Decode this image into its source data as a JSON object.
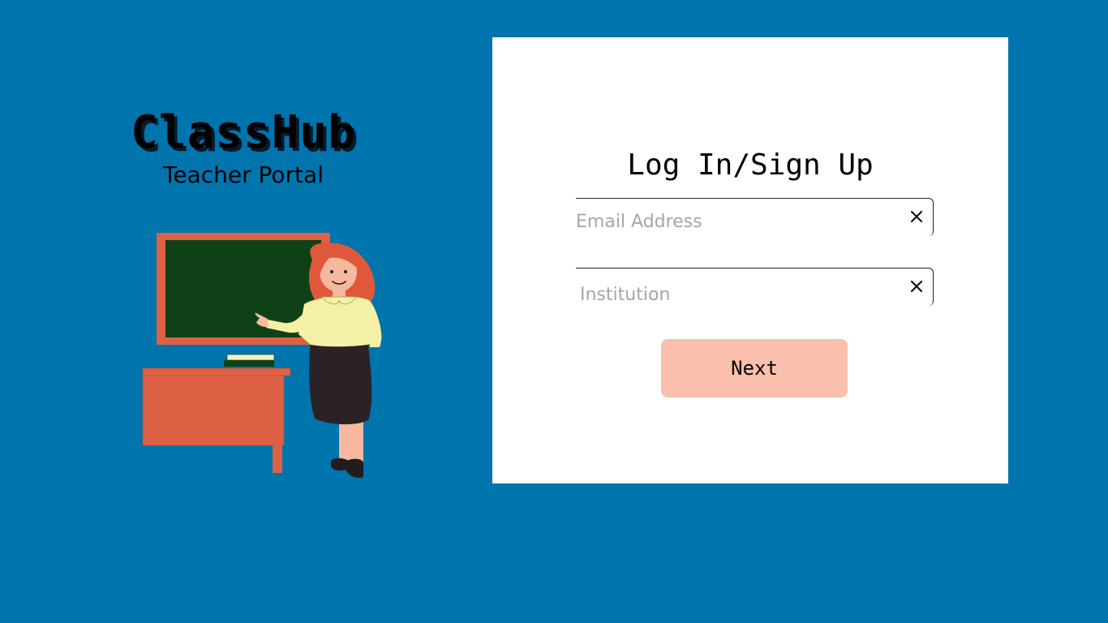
{
  "brand": {
    "title": "ClassHub",
    "subtitle": "Teacher Portal"
  },
  "illustration": {
    "icon": "teacher-at-chalkboard-illustration"
  },
  "login": {
    "title": "Log In/Sign Up",
    "email_placeholder": "Email Address",
    "email_value": "",
    "institution_placeholder": "Institution",
    "institution_value": "",
    "clear_icon": "close-icon",
    "next_label": "Next"
  },
  "colors": {
    "background": "#0074ad",
    "card": "#ffffff",
    "button": "#fabfad",
    "chalkboard_frame": "#de6145",
    "chalkboard": "#0e4216",
    "desk": "#de6145"
  }
}
